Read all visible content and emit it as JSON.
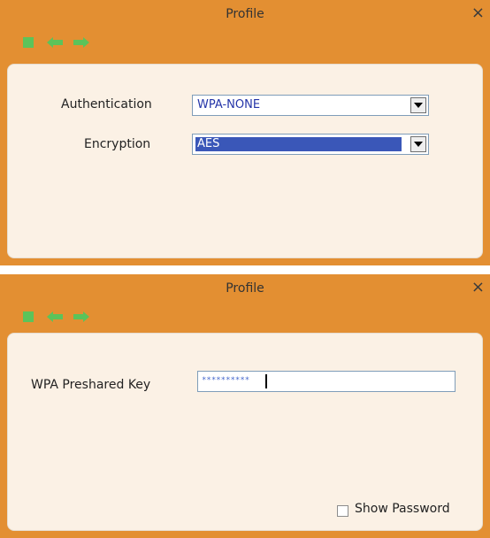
{
  "window1": {
    "title": "Profile",
    "close_glyph": "×",
    "nav_icons": [
      "stop-icon",
      "back-arrow-icon",
      "forward-arrow-icon"
    ],
    "authentication_label": "Authentication",
    "authentication_value": "WPA-NONE",
    "encryption_label": "Encryption",
    "encryption_value": "AES"
  },
  "window2": {
    "title": "Profile",
    "close_glyph": "×",
    "nav_icons": [
      "stop-icon",
      "back-arrow-icon",
      "forward-arrow-icon"
    ],
    "preshared_key_label": "WPA Preshared Key",
    "preshared_key_value": "**********",
    "show_password_label": "Show Password"
  },
  "colors": {
    "title_bar": "#e38f32",
    "panel": "#fbf1e5",
    "nav_icon": "#5cc35a",
    "selection": "#3a57b8"
  }
}
